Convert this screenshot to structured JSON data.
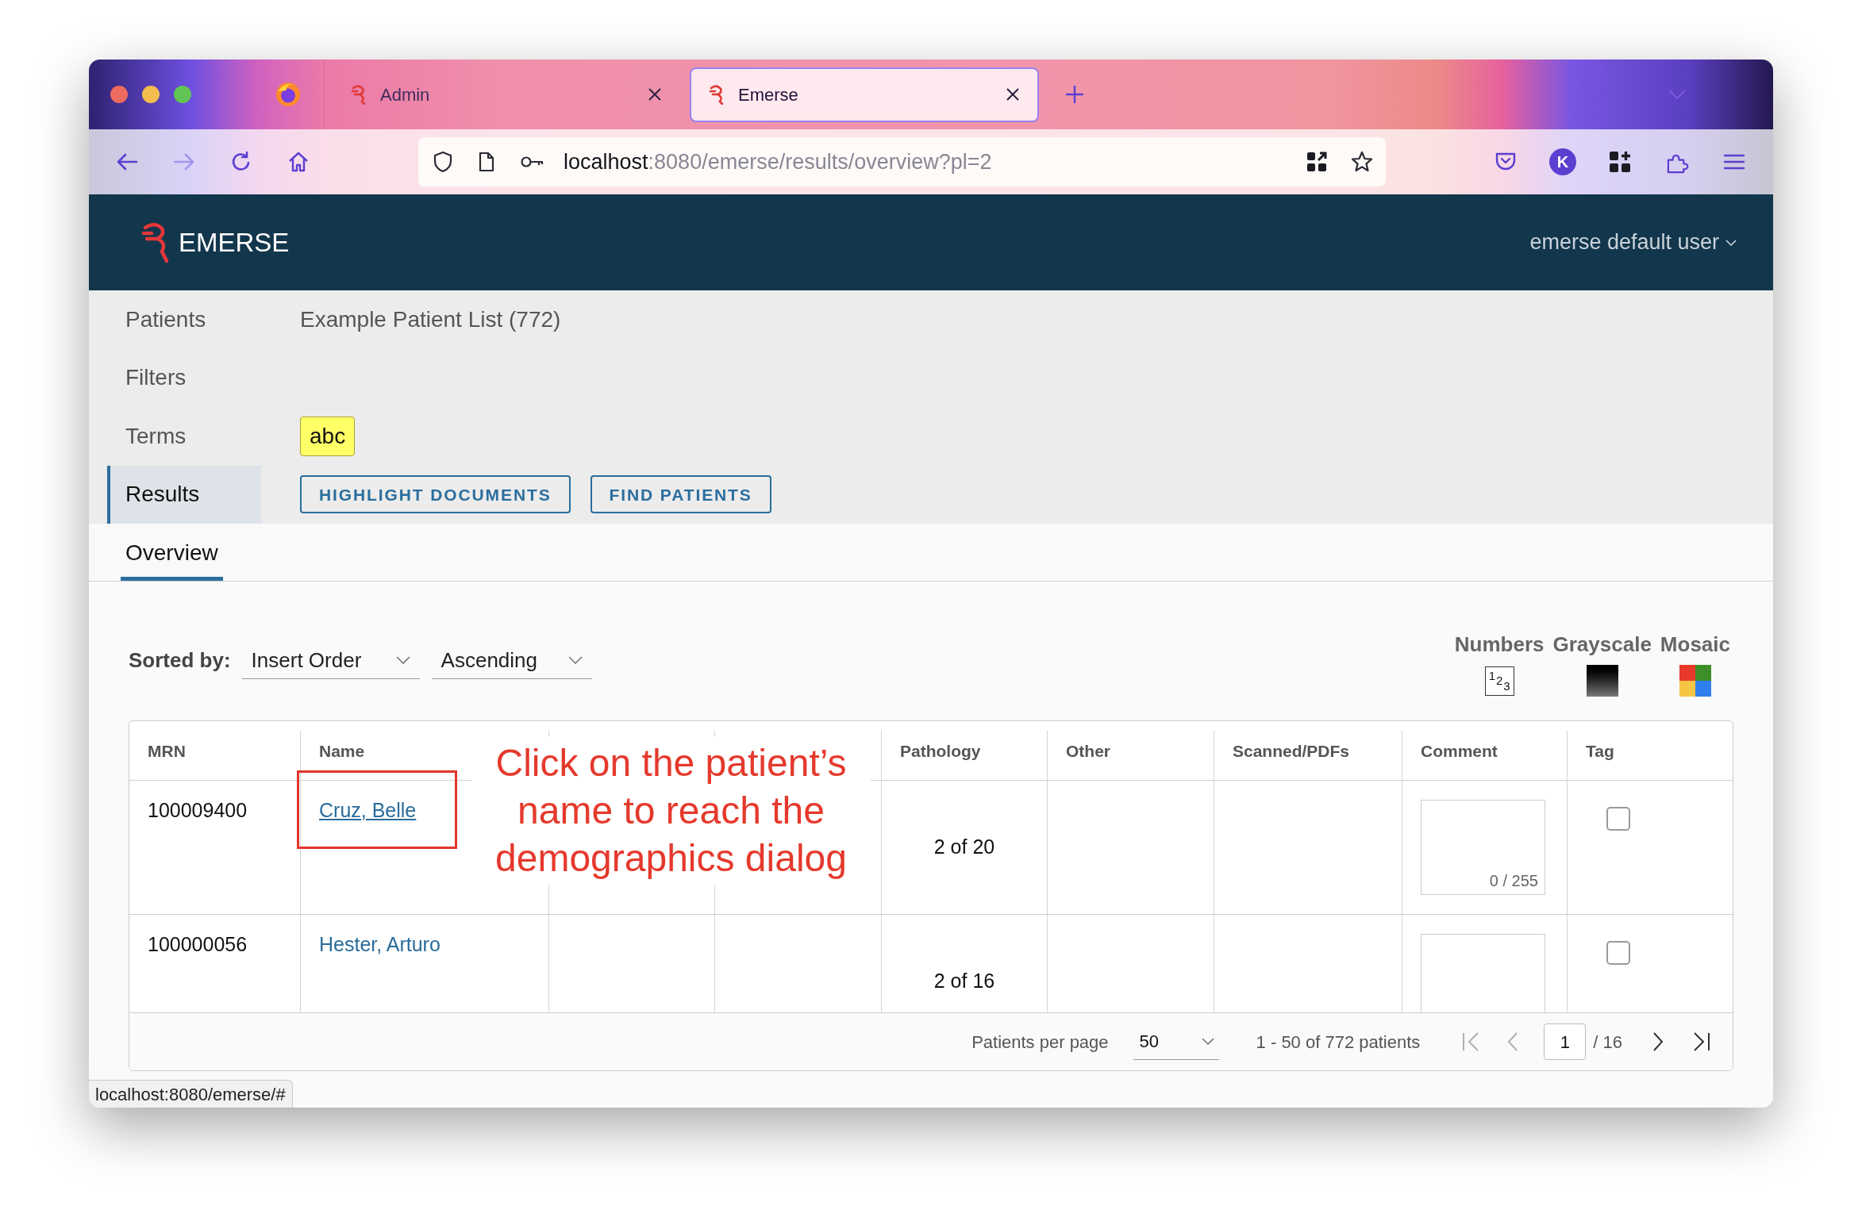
{
  "browser": {
    "tabs": [
      {
        "title": "Admin",
        "selected": false
      },
      {
        "title": "Emerse",
        "selected": true
      }
    ],
    "address": {
      "host": "localhost",
      "rest": ":8080/emerse/results/overview?pl=2"
    },
    "account_initial": "K"
  },
  "app_header": {
    "brand": "EMERSE",
    "user_menu": "emerse default user"
  },
  "sidebar": {
    "items": [
      {
        "label": "Patients",
        "selected": false
      },
      {
        "label": "Filters",
        "selected": false
      },
      {
        "label": "Terms",
        "selected": false
      },
      {
        "label": "Results",
        "selected": true
      }
    ]
  },
  "patient_list": "Example Patient List (772)",
  "terms": [
    {
      "label": "abc",
      "color": "#ffff66"
    }
  ],
  "actions": [
    "HIGHLIGHT DOCUMENTS",
    "FIND PATIENTS"
  ],
  "view_tabs": [
    {
      "label": "Overview",
      "selected": true
    }
  ],
  "sort": {
    "label": "Sorted by:",
    "field": "Insert Order",
    "order": "Ascending"
  },
  "display_modes": [
    {
      "label": "Numbers",
      "kind": "numbers",
      "digits": [
        "1",
        "2",
        "3"
      ]
    },
    {
      "label": "Grayscale",
      "kind": "grayscale"
    },
    {
      "label": "Mosaic",
      "kind": "mosaic"
    }
  ],
  "table": {
    "columns": [
      "MRN",
      "Name",
      null,
      null,
      "Pathology",
      "Other",
      "Scanned/PDFs",
      "Comment",
      "Tag"
    ],
    "rows": [
      {
        "mrn": "100009400",
        "name": "Cruz, Belle",
        "hovered": true,
        "pathology": "2 of 20",
        "comment_counter": "0 / 255",
        "tagged": false
      },
      {
        "mrn": "100000056",
        "name": "Hester, Arturo",
        "hovered": false,
        "pathology": "2 of 16",
        "tagged": false
      }
    ]
  },
  "pagination": {
    "per_page_label": "Patients per page",
    "per_page": "50",
    "range": "1 - 50 of 772 patients",
    "page": "1",
    "page_total": "/ 16",
    "buttons": [
      {
        "kind": "first",
        "disabled": true
      },
      {
        "kind": "previous",
        "disabled": true
      },
      {
        "kind": "next",
        "disabled": false
      },
      {
        "kind": "last",
        "disabled": false
      }
    ]
  },
  "annotation": {
    "lines": [
      "Click on the patient’s",
      "name to reach the",
      "demographics dialog"
    ]
  },
  "status_bar": "localhost:8080/emerse/#"
}
